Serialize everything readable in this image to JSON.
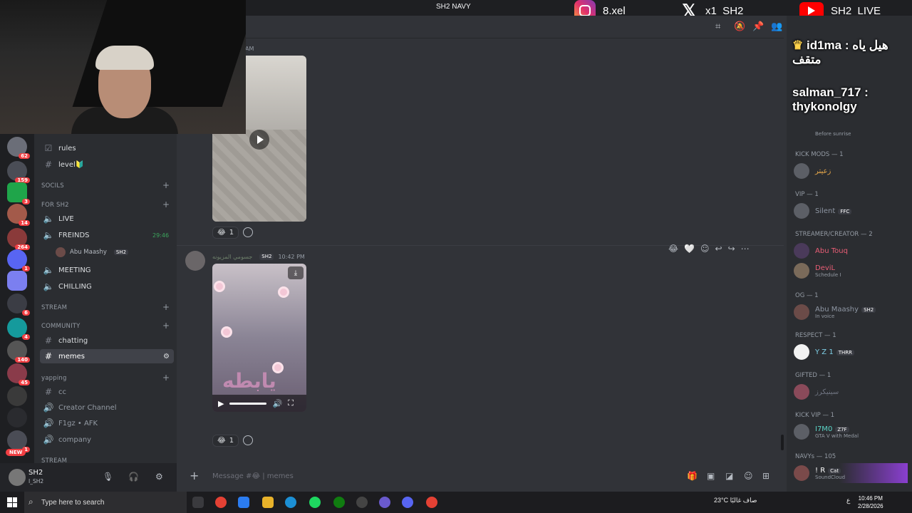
{
  "window": {
    "title": "SH2 NAVY"
  },
  "socials": {
    "instagram": "8.xel",
    "x": "x1_SH2",
    "youtube": "SH2_LIVE"
  },
  "servers": {
    "badges": [
      "62",
      "159",
      "3",
      "14",
      "264",
      "1",
      "6",
      "4",
      "140",
      "45",
      "1"
    ],
    "new_label": "NEW"
  },
  "sidebar": {
    "items": [
      {
        "label": "rules",
        "sym": "☑",
        "type": "text"
      },
      {
        "label": "level🔰",
        "sym": "#",
        "type": "text"
      }
    ],
    "categories": {
      "socials": "SOCILS",
      "forsh2": "FOR SH2",
      "stream": "STREAM",
      "community": "COMMUNITY",
      "yapping": "yapping",
      "stream2": "STREAM"
    },
    "voice": [
      {
        "label": "LIVE"
      },
      {
        "label": "FREINDS",
        "timer": "29:46"
      },
      {
        "label": "MEETING"
      },
      {
        "label": "CHILLING"
      }
    ],
    "voice_user": "Abu Maashy",
    "voice_user_tag": "SH2",
    "community": [
      {
        "label": "chatting"
      },
      {
        "label": "memes"
      }
    ],
    "yapping": [
      {
        "label": "cc",
        "sym": "#"
      },
      {
        "label": "Creator Channel",
        "sym": "🔊"
      },
      {
        "label": "F1gz • AFK",
        "sym": "🔊"
      },
      {
        "label": "company",
        "sym": "🔊"
      }
    ]
  },
  "user": {
    "name": "SH2",
    "status": "I_SH2"
  },
  "chat": {
    "msg_time": "10:42 PM",
    "msg_author": "جسومي المزيونه",
    "msg_tag": "SH2",
    "video_caption": "يابطه",
    "reaction_count_1": "1",
    "reaction_count_2": "1",
    "input_placeholder": "Message #😂 | memes",
    "top_time_fragment": "AM"
  },
  "overlay_chat": [
    {
      "user": "id1ma",
      "text": "هيل ياه : متقف"
    },
    {
      "user": "salman_717",
      "text": ": thykonolgy"
    }
  ],
  "members": {
    "categories": [
      "KICK MODS — 1",
      "VIP — 1",
      "STREAMER/CREATOR — 2",
      "OG — 1",
      "RESPECT — 1",
      "GIFTED — 1",
      "KICK VIP — 1",
      "NAVYs — 105"
    ],
    "list": [
      {
        "name": "زعيتر",
        "color": "#e8a84a",
        "status": ""
      },
      {
        "name": "Silent",
        "color": "#8e96a3",
        "tag": "FFC",
        "status": ""
      },
      {
        "name": "Abu Touq",
        "color": "#e85d75",
        "status": ""
      },
      {
        "name": "DeviL",
        "color": "#e85d75",
        "status": "Schedule I"
      },
      {
        "name": "Abu Maashy",
        "color": "#8e96a3",
        "tag": "SH2",
        "status": "In voice"
      },
      {
        "name": "Y Z 1",
        "color": "#7fd0e8",
        "tag": "THRR",
        "status": ""
      },
      {
        "name": "سينيكرز",
        "color": "#6f7480",
        "status": ""
      },
      {
        "name": "I7M0",
        "color": "#5bd6c8",
        "tag": "Z7F",
        "status": "GTA V with Medal"
      },
      {
        "name": "! R",
        "color": "#ffffff",
        "tag": "Cat",
        "status": "SoundCloud"
      }
    ],
    "top_status": "Before sunrise"
  },
  "taskbar": {
    "search_placeholder": "Type here to search",
    "weather": "23°C  صاف غالبًا",
    "time": "10:46 PM",
    "date": "2/28/2026",
    "lang": "ع"
  }
}
